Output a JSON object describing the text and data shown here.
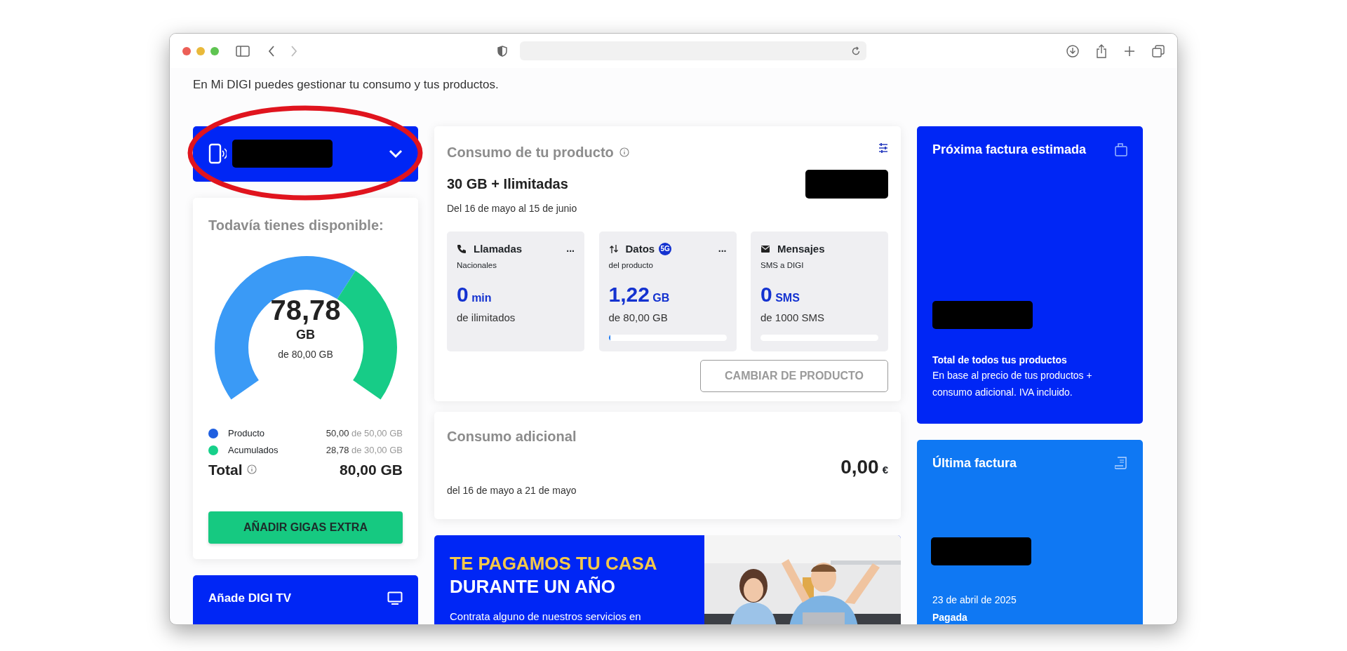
{
  "intro": "En Mi DIGI puedes gestionar tu consumo y tus productos.",
  "line_selector": {
    "redacted": true,
    "highlighted": true
  },
  "available": {
    "title": "Todavía tienes disponible:",
    "value": "78,78",
    "unit": "GB",
    "caption": "de 80,00 GB",
    "legend": [
      {
        "label": "Producto",
        "used": "50,00",
        "of": " de 50,00 GB",
        "color": "#1f5fe0"
      },
      {
        "label": "Acumulados",
        "used": "28,78",
        "of": " de 30,00 GB",
        "color": "#17d08a"
      }
    ],
    "total_label": "Total",
    "total_value": "80,00 GB",
    "button": "AÑADIR GIGAS EXTRA"
  },
  "tv_card": {
    "title": "Añade DIGI TV"
  },
  "product": {
    "title": "Consumo de tu producto",
    "plan": "30 GB + Ilimitadas",
    "price_redacted": true,
    "period": "Del 16 de mayo al 15 de junio",
    "tiles": [
      {
        "kind": "calls",
        "title": "Llamadas",
        "more": "...",
        "subtitle": "Nacionales",
        "value": "0",
        "unit": "min",
        "caption": "de ilimitados"
      },
      {
        "kind": "data",
        "title": "Datos",
        "badge": "5G",
        "more": "...",
        "subtitle": "del producto",
        "value": "1,22",
        "unit": "GB",
        "caption": "de 80,00 GB",
        "level": 0.015
      },
      {
        "kind": "sms",
        "title": "Mensajes",
        "subtitle": "SMS a DIGI",
        "value": "0",
        "unit": "SMS",
        "caption": "de 1000 SMS",
        "level": 0
      }
    ],
    "button": "CAMBIAR DE PRODUCTO"
  },
  "extra": {
    "title": "Consumo adicional",
    "amount": "0,00",
    "currency": "€",
    "period": "del 16 de mayo a 21 de mayo"
  },
  "banner": {
    "line_1": "TE PAGAMOS TU CASA",
    "line_2": "DURANTE UN AÑO",
    "text": "Contrata alguno de nuestros servicios en"
  },
  "next_bill": {
    "title": "Próxima factura estimada",
    "amount_redacted": true,
    "note_title": "Total de todos tus productos",
    "note": "En base al precio de tus productos + consumo adicional. IVA incluido."
  },
  "last_bill": {
    "title": "Última factura",
    "amount_redacted": true,
    "date": "23 de abril de 2025",
    "status": "Pagada"
  }
}
